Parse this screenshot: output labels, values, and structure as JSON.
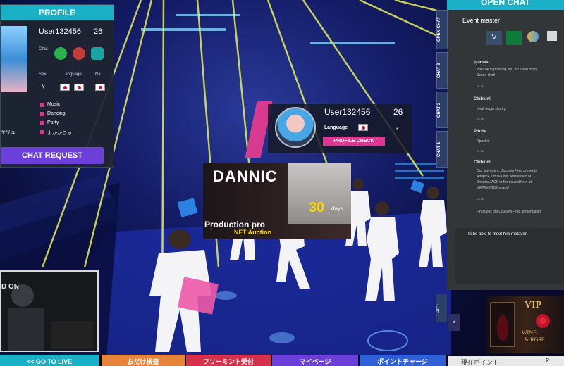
{
  "colors": {
    "accent": "#1ab1c7",
    "pink": "#d73a8e",
    "purple": "#6b3fd8",
    "chat_tab": "#2c3f69",
    "gold": "#d8b86a"
  },
  "profile": {
    "title": "PROFILE",
    "username": "User132456",
    "age": "26",
    "chat_label": "Chat",
    "sex_label": "Sex",
    "language_label": "Language",
    "nationality_label": "Na.",
    "interests": [
      "Music",
      "Dancing",
      "Party",
      "よかかりゅ"
    ],
    "left_interests": [
      "",
      "",
      "ゲリュ"
    ],
    "chat_request": "CHAT REQUEST",
    "icons": [
      "profile-female-icon",
      "chat-green-icon",
      "video-red-icon",
      "message-teal-icon"
    ]
  },
  "user_card": {
    "username": "User132456",
    "age": "26",
    "language_label": "Language",
    "profile_check": "PROFILE CHECK"
  },
  "billboard": {
    "brand": "DANNIC",
    "number": "30",
    "days": "days",
    "production": "Production pro",
    "nft": "NFT Auction",
    "now": "NOW"
  },
  "video_inset": {
    "text": "D ON"
  },
  "chat": {
    "title": "OPEN CHAT",
    "tabs": [
      "OPEN CHAT",
      "CHAT 3",
      "CHAT 2",
      "CHAT 1"
    ],
    "event_master": "Event master",
    "event_v": "V",
    "messages": [
      {
        "user": "pjames",
        "lines": [
          "We'll be supporting you, so listen in on",
          "Scene chat!"
        ],
        "time": "20:16"
      },
      {
        "user": "Clubkini",
        "lines": [
          "It will begin shortly."
        ],
        "time": "20:16"
      },
      {
        "user": "Pitcha",
        "lines": [
          "Rpochiii"
        ],
        "time": "20:16"
      },
      {
        "user": "Clubkini",
        "lines": [
          "Our first event, DiscoverFeed presents",
          "Afrojack Virtual Live, will be held at",
          "Sneaka JACK in Korea and here at",
          "METAVERSE space!"
        ],
        "time": "20:16"
      },
      {
        "user": "",
        "lines": [
          "Find up is the DiscoverFeed presentation"
        ],
        "time": ""
      }
    ],
    "input_text": "to be able to meet him metaver_"
  },
  "gift": {
    "tab": "GIFT",
    "arrow": "<",
    "vip": "VIP",
    "wine": "WINE",
    "rose": "& ROSE"
  },
  "bottom_bar": {
    "go_live": "<< GO TO LIVE",
    "btn2": "おだけ検査",
    "btn3": "フリーミント受付",
    "btn4": "マイページ",
    "btn5": "ポイントチャージ",
    "points_label": "現在ポイント",
    "points_value": "2"
  }
}
